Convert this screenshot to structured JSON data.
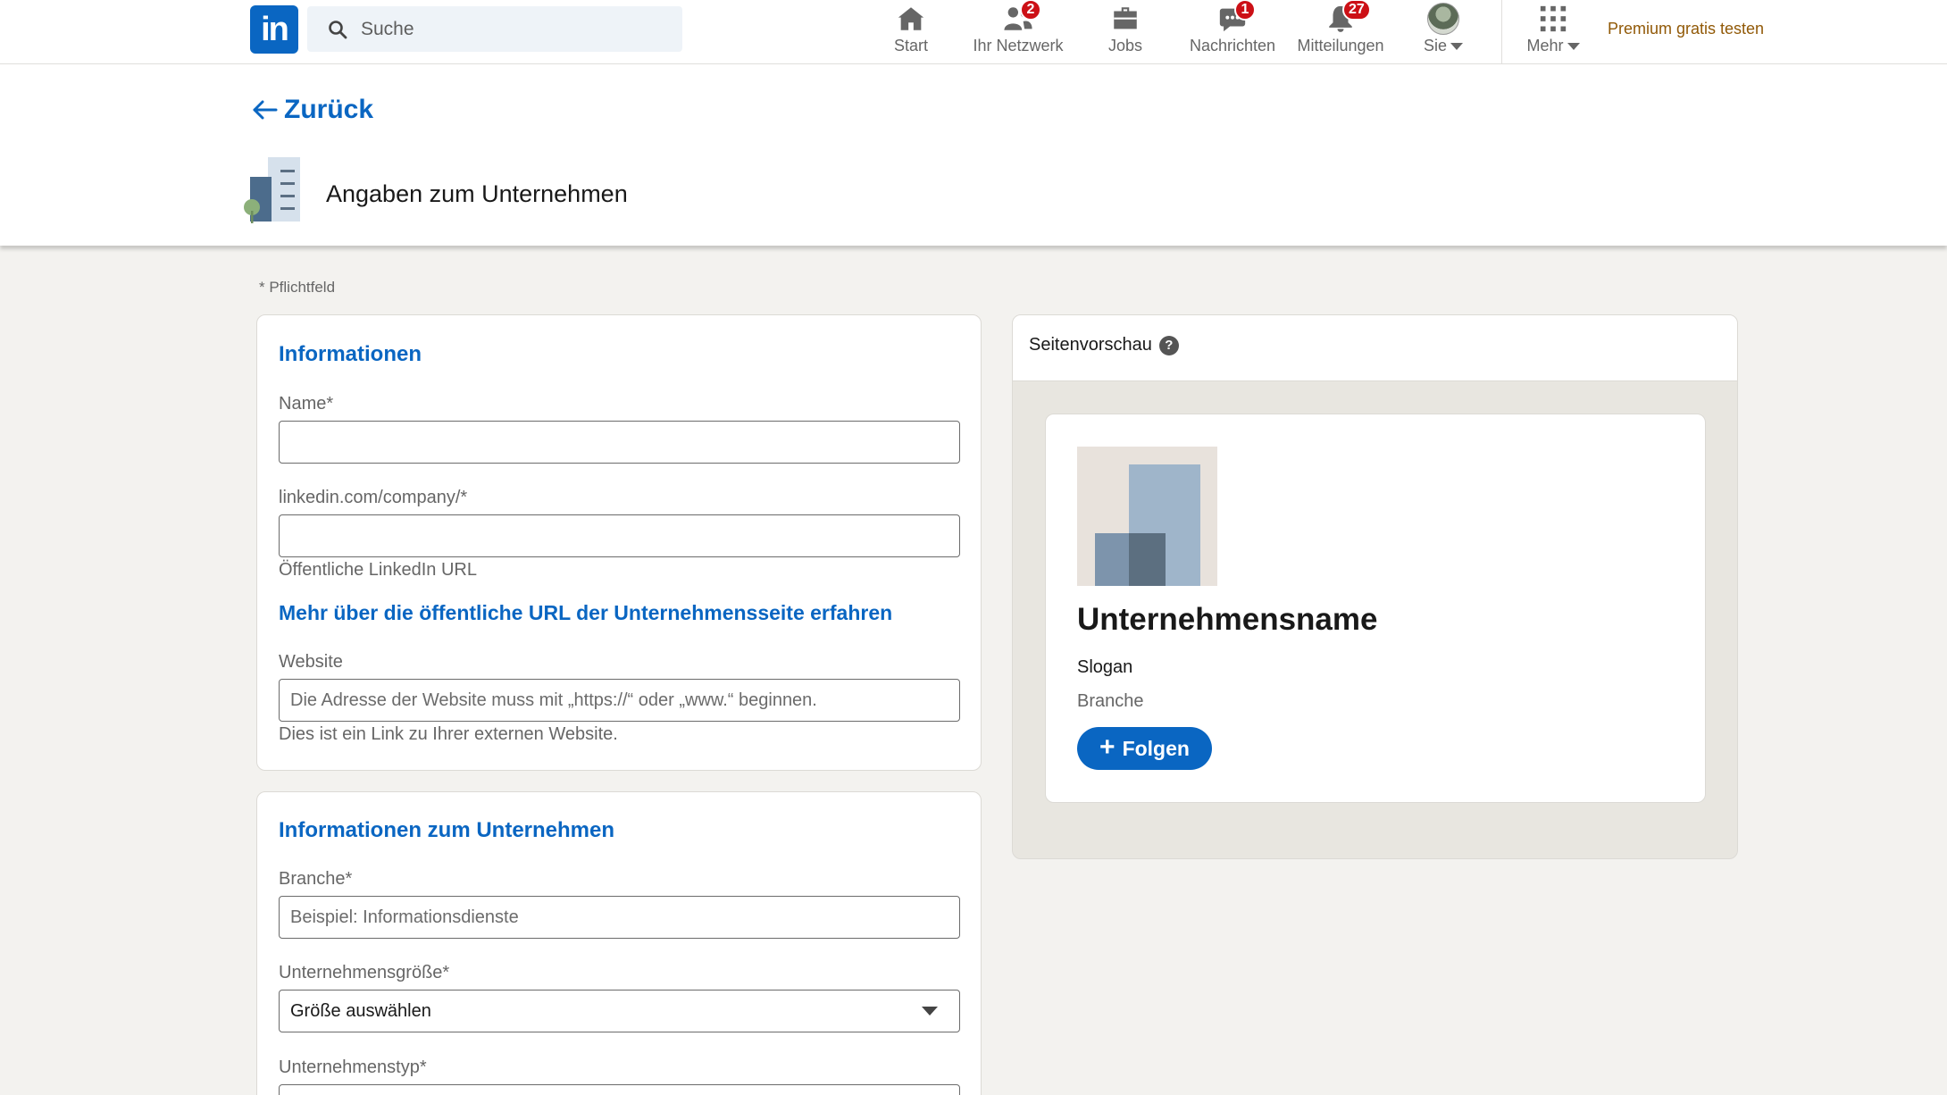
{
  "nav": {
    "logo_text": "in",
    "search_placeholder": "Suche",
    "items": [
      {
        "label": "Start",
        "icon": "home-icon"
      },
      {
        "label": "Ihr Netzwerk",
        "icon": "network-icon",
        "badge": "2"
      },
      {
        "label": "Jobs",
        "icon": "briefcase-icon"
      },
      {
        "label": "Nachrichten",
        "icon": "messaging-icon",
        "badge": "1"
      },
      {
        "label": "Mitteilungen",
        "icon": "bell-icon",
        "badge": "27"
      },
      {
        "label": "Sie",
        "icon": "avatar"
      },
      {
        "label": "Mehr",
        "icon": "grid-icon"
      }
    ],
    "premium": "Premium gratis testen"
  },
  "header": {
    "back_label": "Zurück",
    "title": "Angaben zum Unternehmen"
  },
  "form": {
    "required_note": "*  Pflichtfeld",
    "info": {
      "title": "Informationen",
      "name_label": "Name*",
      "name_value": "",
      "url_label": "linkedin.com/company/*",
      "url_value": "",
      "url_hint": "Öffentliche LinkedIn URL",
      "url_link": "Mehr über die öffentliche URL der Unternehmensseite erfahren",
      "website_label": "Website",
      "website_placeholder": "Die Adresse der Website muss mit „https://“ oder „www.“ beginnen.",
      "website_hint": "Dies ist ein Link zu Ihrer externen Website."
    },
    "company": {
      "title": "Informationen zum Unternehmen",
      "industry_label": "Branche*",
      "industry_placeholder": "Beispiel: Informationsdienste",
      "size_label": "Unternehmensgröße*",
      "size_selected": "Größe auswählen",
      "type_label": "Unternehmenstyp*"
    }
  },
  "preview": {
    "title": "Seitenvorschau",
    "help": "?",
    "company_name": "Unternehmensname",
    "slogan": "Slogan",
    "industry": "Branche",
    "follow_label": "Folgen",
    "follow_plus": "+"
  },
  "colors": {
    "accent": "#0a66c2",
    "badge": "#cc1016",
    "premium": "#915907",
    "background": "#f3f2ef"
  }
}
